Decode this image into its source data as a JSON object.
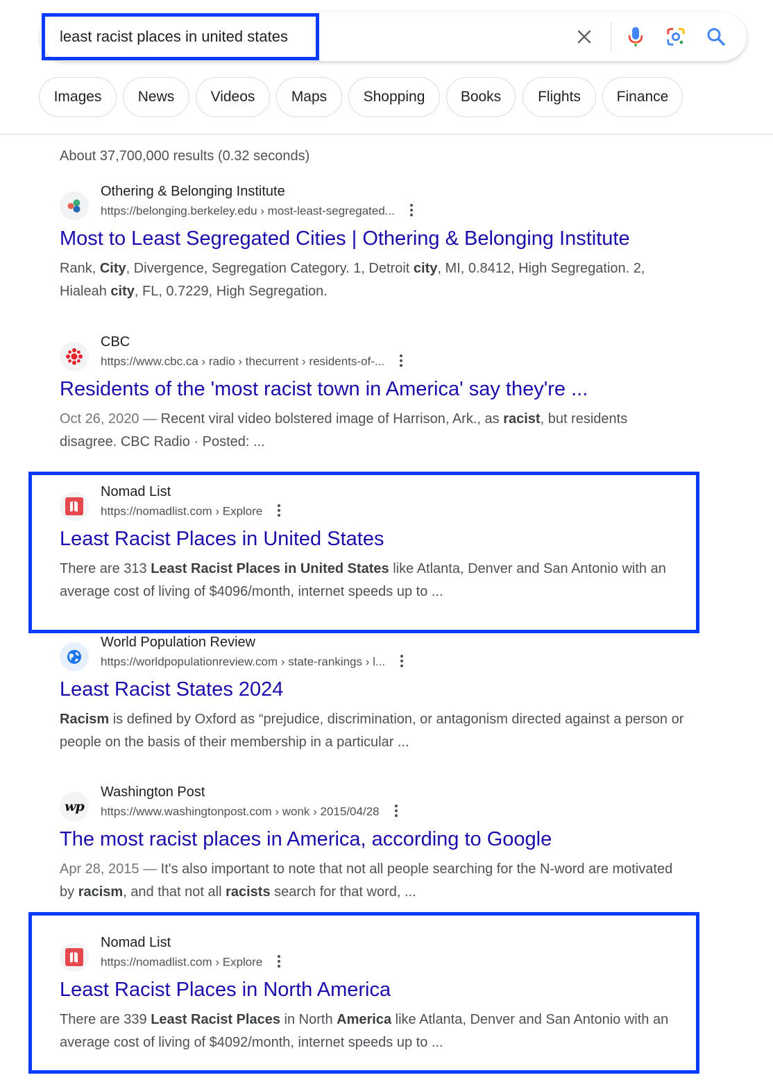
{
  "search": {
    "query": "least racist places in united states",
    "icons": [
      "clear-icon",
      "microphone-icon",
      "lens-icon",
      "search-icon"
    ]
  },
  "chips": [
    "Images",
    "News",
    "Videos",
    "Maps",
    "Shopping",
    "Books",
    "Flights",
    "Finance"
  ],
  "stats": "About 37,700,000 results (0.32 seconds)",
  "results": [
    {
      "site": "Othering & Belonging Institute",
      "url": "https://belonging.berkeley.edu › most-least-segregated...",
      "title": "Most to Least Segregated Cities | Othering & Belonging Institute",
      "snippet_parts": [
        {
          "t": "Rank, "
        },
        {
          "t": "City",
          "b": true
        },
        {
          "t": ", Divergence, Segregation Category. 1, Detroit "
        },
        {
          "t": "city",
          "b": true
        },
        {
          "t": ", MI, 0.8412, High Segregation. 2, Hialeah "
        },
        {
          "t": "city",
          "b": true
        },
        {
          "t": ", FL, 0.7229, High Segregation."
        }
      ],
      "icon": "obi-logo-icon"
    },
    {
      "site": "CBC",
      "url": "https://www.cbc.ca › radio › thecurrent › residents-of-...",
      "title": "Residents of the 'most racist town in America' say they're ...",
      "snippet_parts": [
        {
          "t": "Oct 26, 2020 — ",
          "d": true
        },
        {
          "t": "Recent viral video bolstered image of Harrison, Ark., as "
        },
        {
          "t": "racist",
          "b": true
        },
        {
          "t": ", but residents disagree. CBC Radio · Posted: ..."
        }
      ],
      "icon": "cbc-logo-icon"
    },
    {
      "site": "Nomad List",
      "url": "https://nomadlist.com › Explore",
      "title": "Least Racist Places in United States",
      "snippet_parts": [
        {
          "t": "There are 313 "
        },
        {
          "t": "Least Racist Places in United States",
          "b": true
        },
        {
          "t": " like Atlanta, Denver and San Antonio with an average cost of living of $4096/month, internet speeds up to ..."
        }
      ],
      "icon": "nomadlist-logo-icon"
    },
    {
      "site": "World Population Review",
      "url": "https://worldpopulationreview.com › state-rankings › l...",
      "title": "Least Racist States 2024",
      "snippet_parts": [
        {
          "t": "Racism",
          "b": true
        },
        {
          "t": " is defined by Oxford as “prejudice, discrimination, or antagonism directed against a person or people on the basis of their membership in a particular ..."
        }
      ],
      "icon": "globe-icon"
    },
    {
      "site": "Washington Post",
      "url": "https://www.washingtonpost.com › wonk › 2015/04/28",
      "title": "The most racist places in America, according to Google",
      "snippet_parts": [
        {
          "t": "Apr 28, 2015 — ",
          "d": true
        },
        {
          "t": "It's also important to note that not all people searching for the N-word are motivated by "
        },
        {
          "t": "racism",
          "b": true
        },
        {
          "t": ", and that not all "
        },
        {
          "t": "racists",
          "b": true
        },
        {
          "t": " search for that word, ..."
        }
      ],
      "icon": "wp-logo-icon",
      "logo_text": "wp"
    },
    {
      "site": "Nomad List",
      "url": "https://nomadlist.com › Explore",
      "title": "Least Racist Places in North America",
      "snippet_parts": [
        {
          "t": "There are 339 "
        },
        {
          "t": "Least Racist Places",
          "b": true
        },
        {
          "t": " in North "
        },
        {
          "t": "America",
          "b": true
        },
        {
          "t": " like Atlanta, Denver and San Antonio with an average cost of living of $4092/month, internet speeds up to ..."
        }
      ],
      "icon": "nomadlist-logo-icon"
    }
  ],
  "colors": {
    "link": "#1a0dab",
    "highlight": "#0a3bff",
    "snippet": "#4d5156"
  }
}
